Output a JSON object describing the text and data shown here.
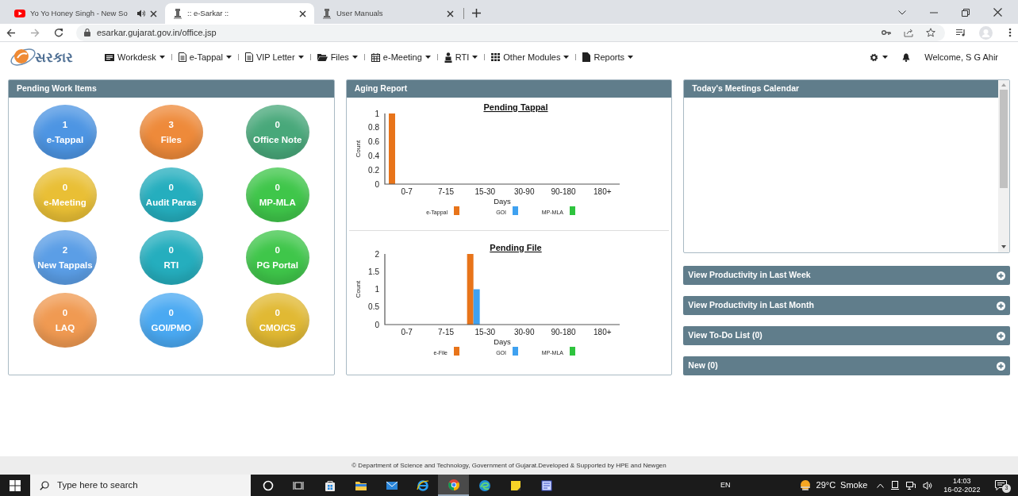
{
  "browser": {
    "tabs": [
      {
        "title": "Yo Yo Honey Singh - New So",
        "kind": "video",
        "audio": true,
        "selected": false
      },
      {
        "title": ":: e-Sarkar ::",
        "kind": "emblem",
        "audio": false,
        "selected": true
      },
      {
        "title": "User Manuals",
        "kind": "emblem",
        "audio": false,
        "selected": false
      }
    ],
    "url": "esarkar.gujarat.gov.in/office.jsp"
  },
  "app": {
    "logo_text": "સરકાર",
    "menu": [
      {
        "label": "Workdesk",
        "kind": "desk"
      },
      {
        "label": "e-Tappal",
        "kind": "doc"
      },
      {
        "label": "VIP Letter",
        "kind": "doc"
      },
      {
        "label": "Files",
        "kind": "folder"
      },
      {
        "label": "e-Meeting",
        "kind": "calendar"
      },
      {
        "label": "RTI",
        "kind": "person"
      },
      {
        "label": "Other Modules",
        "kind": "grid"
      },
      {
        "label": "Reports",
        "kind": "file"
      }
    ],
    "user": "Welcome, S G Ahir"
  },
  "pending_work": {
    "title": "Pending Work Items",
    "items": [
      {
        "count": "1",
        "label": "e-Tappal",
        "color": "#4d95e3"
      },
      {
        "count": "3",
        "label": "Files",
        "color": "#ee8a3a"
      },
      {
        "count": "0",
        "label": "Office Note",
        "color": "#48a87a"
      },
      {
        "count": "0",
        "label": "e-Meeting",
        "color": "#e9bf35"
      },
      {
        "count": "0",
        "label": "Audit Paras",
        "color": "#25aebe"
      },
      {
        "count": "0",
        "label": "MP-MLA",
        "color": "#3fc64a"
      },
      {
        "count": "2",
        "label": "New Tappals",
        "color": "#5b9ee6"
      },
      {
        "count": "0",
        "label": "RTI",
        "color": "#25aebe"
      },
      {
        "count": "0",
        "label": "PG Portal",
        "color": "#3fc64a"
      },
      {
        "count": "0",
        "label": "LAQ",
        "color": "#f09a52"
      },
      {
        "count": "0",
        "label": "GOI/PMO",
        "color": "#4aa9f2"
      },
      {
        "count": "0",
        "label": "CMO/CS",
        "color": "#e1b933"
      }
    ]
  },
  "aging_report": {
    "title": "Aging Report",
    "charts": [
      {
        "chart_data": {
          "type": "bar",
          "legend": "bottom",
          "title": "Pending Tappal",
          "xlabel": "Days",
          "ylabel": "Count",
          "categories": [
            "0-7",
            "7-15",
            "15-30",
            "30-90",
            "90-180",
            "180+"
          ],
          "ylim": [
            0,
            1
          ],
          "yticks": [
            0,
            0.2,
            0.4,
            0.6,
            0.8,
            1
          ],
          "series": [
            {
              "name": "e-Tappal",
              "color": "#e8741a",
              "values": [
                1,
                0,
                0,
                0,
                0,
                0
              ]
            },
            {
              "name": "GOI",
              "color": "#3fa1f0",
              "values": [
                0,
                0,
                0,
                0,
                0,
                0
              ]
            },
            {
              "name": "MP-MLA",
              "color": "#2ec43e",
              "values": [
                0,
                0,
                0,
                0,
                0,
                0
              ]
            }
          ]
        }
      },
      {
        "chart_data": {
          "type": "bar",
          "legend": "bottom",
          "title": "Pending File",
          "xlabel": "Days",
          "ylabel": "Count",
          "categories": [
            "0-7",
            "7-15",
            "15-30",
            "30-90",
            "90-180",
            "180+"
          ],
          "ylim": [
            0,
            2
          ],
          "yticks": [
            0,
            0.5,
            1,
            1.5,
            2
          ],
          "series": [
            {
              "name": "e-File",
              "color": "#e8741a",
              "values": [
                0,
                0,
                2,
                0,
                0,
                0
              ]
            },
            {
              "name": "GOI",
              "color": "#3fa1f0",
              "values": [
                0,
                0,
                1,
                0,
                0,
                0
              ]
            },
            {
              "name": "MP-MLA",
              "color": "#2ec43e",
              "values": [
                0,
                0,
                0,
                0,
                0,
                0
              ]
            }
          ]
        }
      }
    ]
  },
  "calendar": {
    "title": "Today's Meetings Calendar"
  },
  "accordions": [
    {
      "label": "View Productivity in Last Week",
      "expanded": false
    },
    {
      "label": "View Productivity in Last Month",
      "expanded": false
    },
    {
      "label": "View To-Do List (0)",
      "expanded": false
    },
    {
      "label": "New (0)",
      "expanded": false
    }
  ],
  "footer": "© Department of Science and Technology, Government of Gujarat.Developed & Supported by HPE and Newgen",
  "taskbar": {
    "search_placeholder": "Type here to search",
    "apps": [
      {
        "kind": "cortana",
        "selected": false
      },
      {
        "kind": "taskview",
        "selected": false
      },
      {
        "kind": "store",
        "selected": false
      },
      {
        "kind": "explorer",
        "selected": false
      },
      {
        "kind": "mail",
        "selected": false
      },
      {
        "kind": "ie",
        "selected": false
      },
      {
        "kind": "chrome",
        "selected": true
      },
      {
        "kind": "edge",
        "selected": false
      },
      {
        "kind": "sticky",
        "selected": false
      },
      {
        "kind": "window",
        "selected": false
      }
    ],
    "language": "EN",
    "temperature": "29°C",
    "weather": "Smoke",
    "time": "14:03",
    "date": "16-02-2022",
    "notifications": "3"
  }
}
